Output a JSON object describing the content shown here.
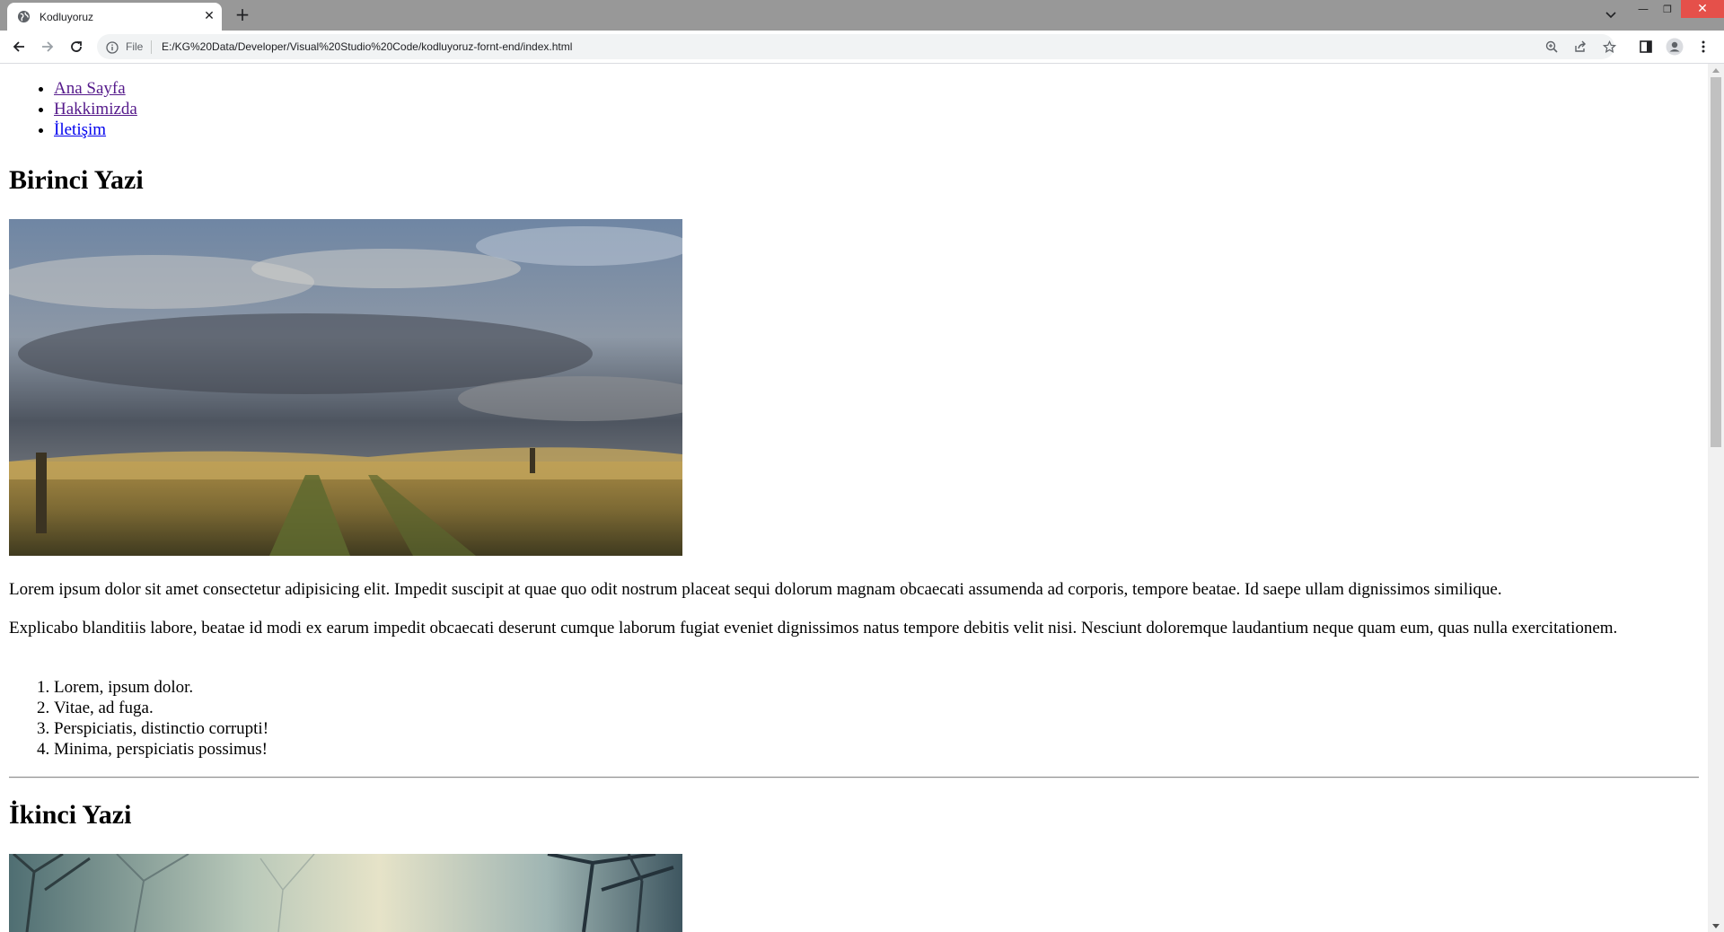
{
  "browser": {
    "tab_title": "Kodluyoruz",
    "address_scheme_label": "File",
    "address_url": "E:/KG%20Data/Developer/Visual%20Studio%20Code/kodluyoruz-fornt-end/index.html",
    "icons": [
      "globe-icon",
      "close-icon",
      "plus-icon",
      "chevron-down-icon",
      "minimize-icon",
      "restore-icon",
      "close-icon",
      "back-arrow-icon",
      "forward-arrow-icon",
      "reload-icon",
      "info-icon",
      "zoom-icon",
      "share-icon",
      "bookmark-star-icon",
      "side-panel-icon",
      "profile-icon",
      "more-vert-icon"
    ]
  },
  "page": {
    "nav": [
      {
        "label": "Ana Sayfa"
      },
      {
        "label": "Hakkimizda"
      },
      {
        "label": "İletişim"
      }
    ],
    "posts": [
      {
        "heading": "Birinci Yazi",
        "paragraphs": [
          "Lorem ipsum dolor sit amet consectetur adipisicing elit. Impedit suscipit at quae quo odit nostrum placeat sequi dolorum magnam obcaecati assumenda ad corporis, tempore beatae. Id saepe ullam dignissimos similique.",
          "Explicabo blanditiis labore, beatae id modi ex earum impedit obcaecati deserunt cumque laborum fugiat eveniet dignissimos natus tempore debitis velit nisi. Nesciunt doloremque laudantium neque quam eum, quas nulla exercitationem."
        ],
        "list": [
          "Lorem, ipsum dolor.",
          "Vitae, ad fuga.",
          "Perspiciatis, distinctio corrupti!",
          "Minima, perspiciatis possimus!"
        ]
      },
      {
        "heading": "İkinci Yazi"
      }
    ]
  },
  "colors": {
    "tab_strip": "#989898",
    "visited_link": "#551a8b",
    "link": "#0000ee",
    "close_button": "#e5504a"
  }
}
